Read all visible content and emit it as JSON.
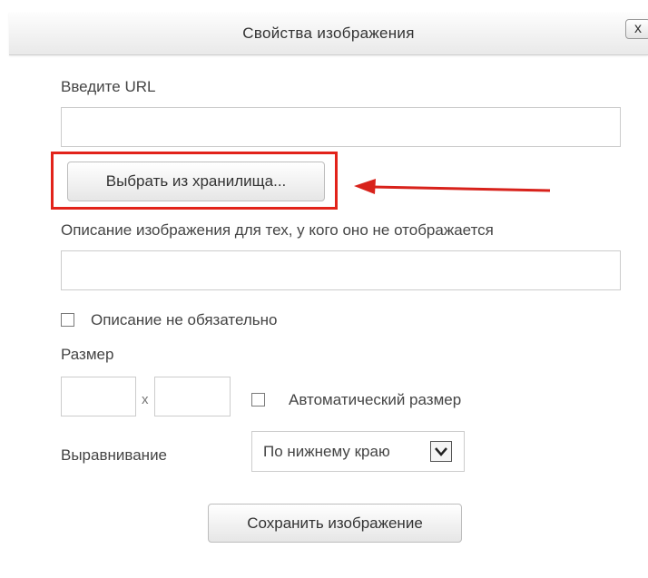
{
  "dialog": {
    "title": "Свойства изображения",
    "close_label": "x"
  },
  "url_field": {
    "label": "Введите URL",
    "value": ""
  },
  "browse_button": {
    "label": "Выбрать из хранилища..."
  },
  "description_field": {
    "label": "Описание изображения для тех, у кого оно не отображается",
    "value": ""
  },
  "description_optional": {
    "label": "Описание не обязательно",
    "checked": false
  },
  "size": {
    "label": "Размер",
    "width_value": "",
    "height_value": "",
    "separator": "x",
    "auto_label": "Автоматический размер",
    "auto_checked": false
  },
  "alignment": {
    "label": "Выравнивание",
    "selected": "По нижнему краю"
  },
  "save_button": {
    "label": "Сохранить изображение"
  },
  "annotation": {
    "color": "#e2231a"
  }
}
